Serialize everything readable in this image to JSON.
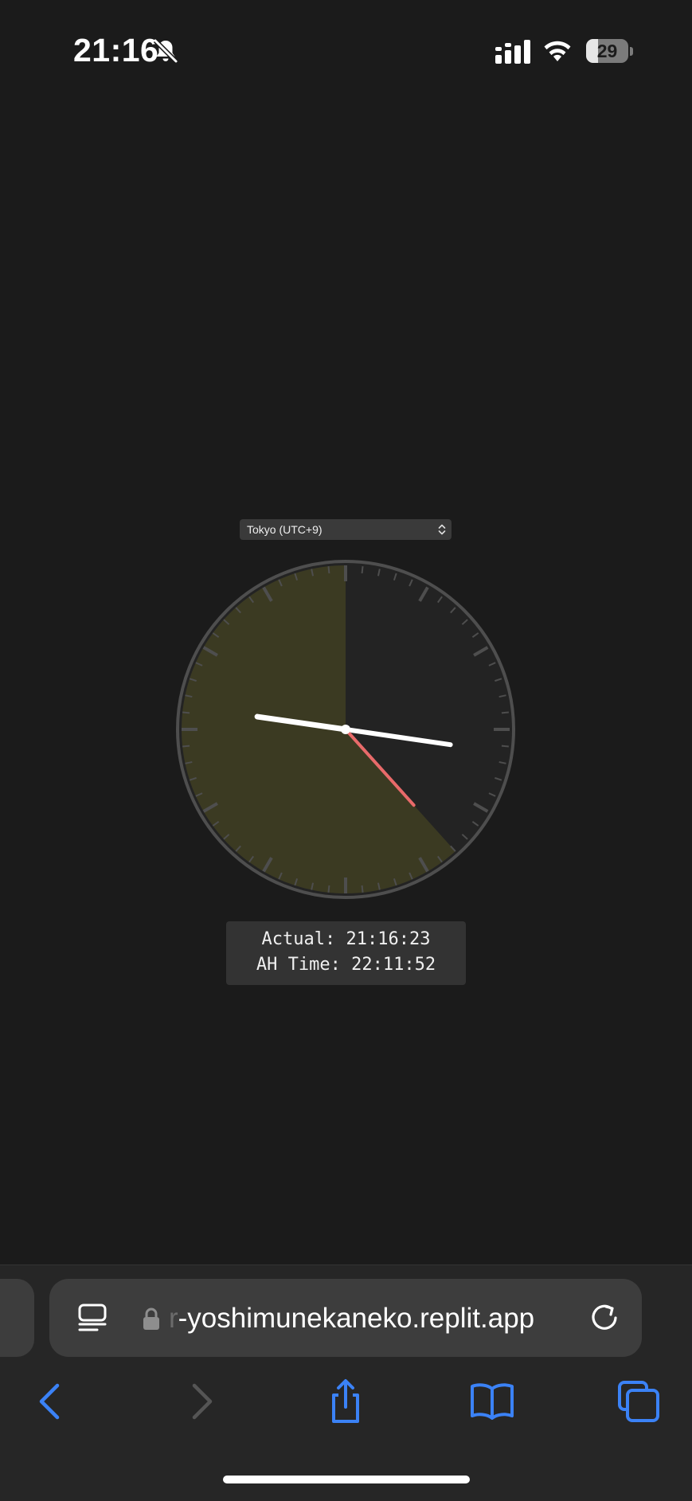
{
  "status_bar": {
    "time": "21:16",
    "battery_level": "29",
    "battery_fraction": 0.29,
    "icons": [
      "bell-slash-icon",
      "cellular-signal-icon",
      "wifi-icon",
      "battery-icon"
    ]
  },
  "timezone_select": {
    "selected": "Tokyo (UTC+9)",
    "icon": "chevron-up-down-icon"
  },
  "clock": {
    "actual_time": "21:16:23",
    "ah_time": "22:11:52",
    "colors": {
      "face": "#232323",
      "ticks": "#4e4e4e",
      "sector": "#3b3a22",
      "hands": "#ffffff",
      "second_hand": "#e86a6a"
    }
  },
  "readout": {
    "actual": "Actual: 21:16:23",
    "ah_time": "AH Time: 22:11:52"
  },
  "browser": {
    "url_prefix": "r",
    "url_main": "-yoshimunekaneko.replit.app",
    "accent": "#3b82f6",
    "icons": [
      "tabs-overview-icon",
      "lock-icon",
      "reload-icon",
      "back-icon",
      "forward-icon",
      "share-icon",
      "bookmarks-icon",
      "tabs-icon"
    ]
  }
}
